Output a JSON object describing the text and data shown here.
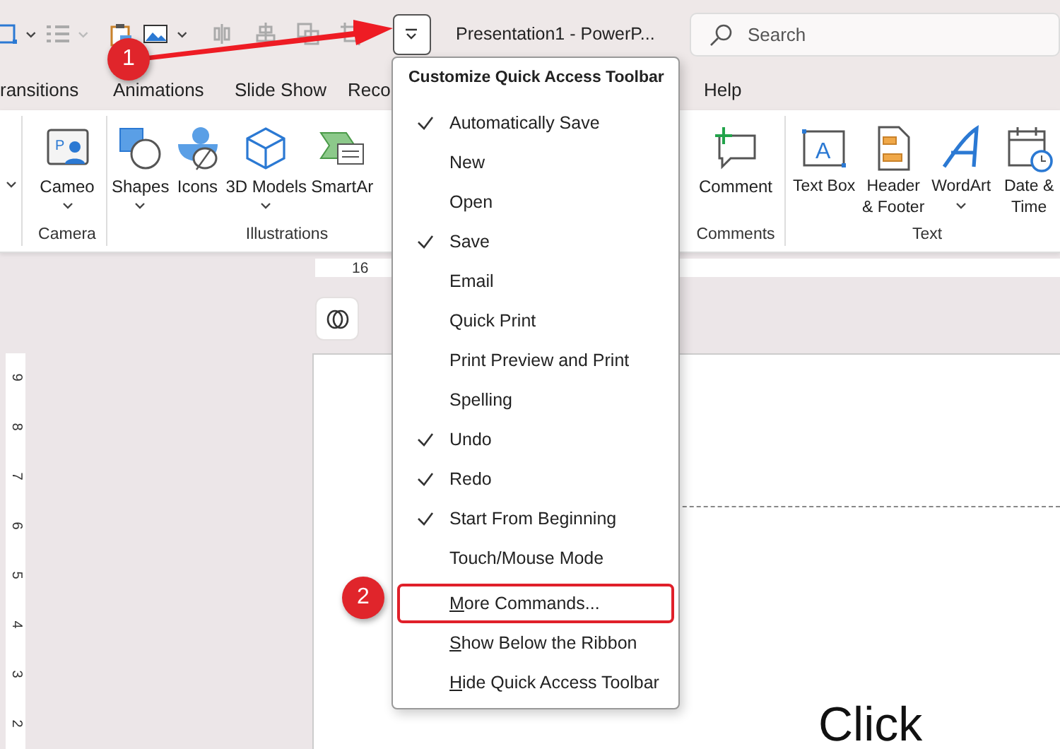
{
  "window": {
    "title": "Presentation1  -  PowerP...",
    "qat_dropdown_open": true
  },
  "search": {
    "placeholder": "Search"
  },
  "tabs": [
    {
      "label": "ransitions",
      "selected": false
    },
    {
      "label": "Animations",
      "selected": false
    },
    {
      "label": "Slide Show",
      "selected": false
    },
    {
      "label": "Reco",
      "selected": false
    },
    {
      "label": "Help",
      "selected": false
    }
  ],
  "ribbon": {
    "groups": [
      {
        "label": "Camera",
        "buttons": [
          {
            "label": "Cameo",
            "kind": "cameo",
            "dropdown": true,
            "icon_letter": "P"
          }
        ]
      },
      {
        "label": "Illustrations",
        "buttons": [
          {
            "label": "Shapes",
            "kind": "shapes",
            "dropdown": true
          },
          {
            "label": "Icons",
            "kind": "icons",
            "dropdown": false
          },
          {
            "label": "3D Models",
            "kind": "models",
            "dropdown": true
          },
          {
            "label": "SmartAr",
            "kind": "smartart",
            "dropdown": false
          }
        ]
      },
      {
        "label": "Comments",
        "buttons": [
          {
            "label": "Comment",
            "kind": "comment",
            "dropdown": false
          }
        ]
      },
      {
        "label": "Text",
        "buttons": [
          {
            "label": "Text Box",
            "kind": "textbox",
            "dropdown": false,
            "icon_letter": "A"
          },
          {
            "label": "Header & Footer",
            "kind": "header",
            "dropdown": false
          },
          {
            "label": "WordArt",
            "kind": "wordart",
            "dropdown": true
          },
          {
            "label": "Date & Time",
            "kind": "datetime",
            "dropdown": false
          }
        ]
      }
    ]
  },
  "top_ruler": {
    "labels": [
      "16"
    ]
  },
  "left_ruler": {
    "labels": [
      "9",
      "8",
      "7",
      "6",
      "5",
      "4",
      "3",
      "2"
    ]
  },
  "slide": {
    "title_text": "Click"
  },
  "menu": {
    "title": "Customize Quick Access Toolbar",
    "items": [
      {
        "label": "Automatically Save",
        "checked": true,
        "outlined": false
      },
      {
        "label": "New",
        "checked": false,
        "outlined": false
      },
      {
        "label": "Open",
        "checked": false,
        "outlined": false
      },
      {
        "label": "Save",
        "checked": true,
        "outlined": false
      },
      {
        "label": "Email",
        "checked": false,
        "outlined": false
      },
      {
        "label": "Quick Print",
        "checked": false,
        "outlined": false
      },
      {
        "label": "Print Preview and Print",
        "checked": false,
        "outlined": false
      },
      {
        "label": "Spelling",
        "checked": false,
        "outlined": false
      },
      {
        "label": "Undo",
        "checked": true,
        "outlined": false
      },
      {
        "label": "Redo",
        "checked": true,
        "outlined": false
      },
      {
        "label": "Start From Beginning",
        "checked": true,
        "outlined": false
      },
      {
        "label": "Touch/Mouse Mode",
        "checked": false,
        "outlined": false
      },
      {
        "label": "More Commands...",
        "checked": false,
        "outlined": true,
        "first_letter_underlined": true
      },
      {
        "label": "Show Below the Ribbon",
        "checked": false,
        "outlined": false,
        "first_letter_underlined": true
      },
      {
        "label": "Hide Quick Access Toolbar",
        "checked": false,
        "outlined": false,
        "first_letter_underlined": true
      }
    ]
  },
  "callouts": [
    {
      "label": "1"
    },
    {
      "label": "2"
    }
  ]
}
